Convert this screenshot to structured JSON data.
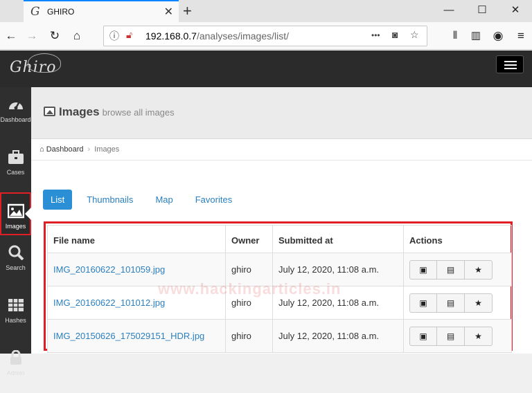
{
  "browser": {
    "tab_title": "GHIRO",
    "tab_favicon": "G",
    "new_tab": "+",
    "win_minimize": "—",
    "win_maximize": "☐",
    "win_close": "✕",
    "url_host": "192.168.0.7",
    "url_path": "/analyses/images/list/",
    "page_actions": "•••"
  },
  "app": {
    "logo_text": "Ghiro",
    "sidebar": [
      {
        "label": "Dashboard",
        "icon": "dashboard-icon"
      },
      {
        "label": "Cases",
        "icon": "briefcase-icon"
      },
      {
        "label": "Images",
        "icon": "image-icon",
        "active": true
      },
      {
        "label": "Search",
        "icon": "search-icon"
      },
      {
        "label": "Hashes",
        "icon": "grid-icon"
      },
      {
        "label": "Admin",
        "icon": "lock-icon"
      }
    ],
    "header": {
      "title": "Images",
      "subtitle": "browse all images"
    },
    "breadcrumb": {
      "home": "Dashboard",
      "current": "Images"
    },
    "tabs": [
      "List",
      "Thumbnails",
      "Map",
      "Favorites"
    ],
    "table": {
      "columns": [
        "File name",
        "Owner",
        "Submitted at",
        "Actions"
      ],
      "rows": [
        {
          "file": "IMG_20160622_101059.jpg",
          "owner": "ghiro",
          "submitted": "July 12, 2020, 11:08 a.m."
        },
        {
          "file": "IMG_20160622_101012.jpg",
          "owner": "ghiro",
          "submitted": "July 12, 2020, 11:08 a.m."
        },
        {
          "file": "IMG_20150626_175029151_HDR.jpg",
          "owner": "ghiro",
          "submitted": "July 12, 2020, 11:08 a.m."
        }
      ]
    },
    "watermark": "www.hackingarticles.in"
  },
  "colors": {
    "accent": "#2a8fd4",
    "highlight": "#e01e26",
    "sidebar": "#2f2f2f"
  }
}
